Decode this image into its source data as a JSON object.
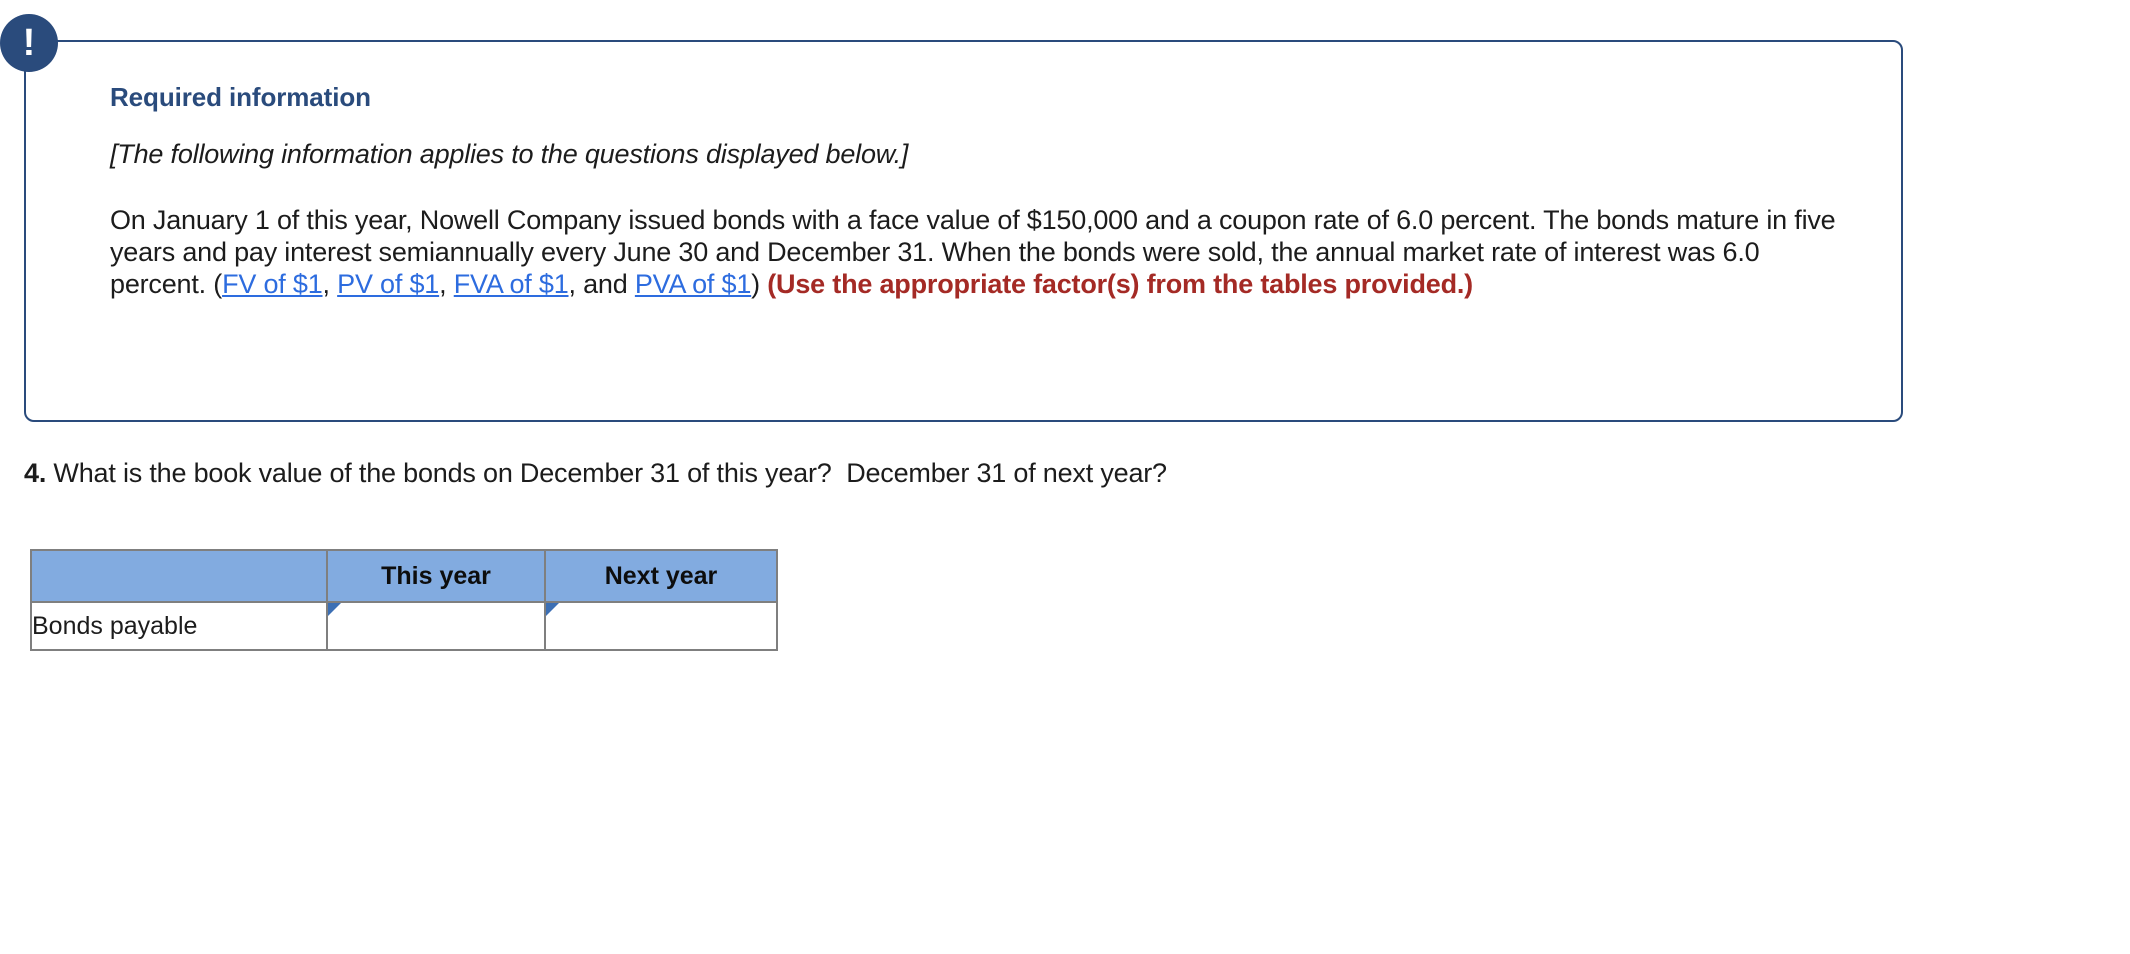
{
  "alert": {
    "icon": "exclamation-icon",
    "icon_glyph": "!",
    "title": "Required information",
    "subtitle": "[The following information applies to the questions displayed below.]",
    "paragraph": {
      "part1": "On January 1 of this year, Nowell Company issued bonds with a face value of $150,000  and a coupon rate of 6.0 percent. The bonds mature in five years and pay interest semiannually every June 30 and December 31. When the bonds were sold, the annual market rate of interest was 6.0 percent. (",
      "link1": "FV of $1",
      "sep1": ", ",
      "link2": "PV of $1",
      "sep2": ", ",
      "link3": "FVA of $1",
      "sep3": ", and ",
      "link4": "PVA of $1",
      "close_paren": ") ",
      "emphasis": "(Use the appropriate factor(s) from the tables provided.)"
    },
    "colors": {
      "border": "#2a4b7c",
      "title": "#2a4b7c",
      "badge": "#2a4b7c",
      "link": "#2d6cdf",
      "emphasis": "#a42a25"
    }
  },
  "question": {
    "number": "4.",
    "text": " What is the book value of the bonds on December 31 of this year?  December 31 of next year?"
  },
  "answer_table": {
    "headers": [
      "",
      "This year",
      "Next year"
    ],
    "rows": [
      {
        "label": "Bonds payable",
        "this_year": "",
        "next_year": "",
        "this_year_placeholder": "",
        "next_year_placeholder": ""
      }
    ],
    "colors": {
      "header_fill": "#82abe0",
      "grid_border": "#7f7f7f",
      "input_border": "#3c6fb4",
      "corner_flag": "#3c6fb4"
    }
  }
}
